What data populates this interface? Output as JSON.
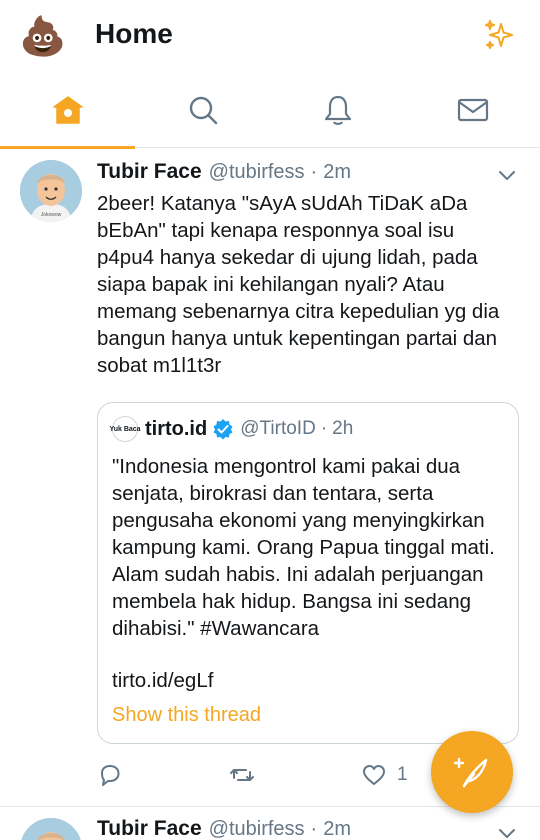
{
  "header": {
    "title": "Home",
    "avatar_icon": "poop-emoji",
    "avatar_glyph": "💩",
    "sparkle_icon": "sparkle-icon"
  },
  "tabs": [
    {
      "name": "home",
      "icon": "home-icon",
      "active": true
    },
    {
      "name": "search",
      "icon": "search-icon",
      "active": false
    },
    {
      "name": "notifications",
      "icon": "bell-icon",
      "active": false
    },
    {
      "name": "messages",
      "icon": "mail-icon",
      "active": false
    }
  ],
  "tweet": {
    "name": "Tubir Face",
    "handle": "@tubirfess",
    "separator": "·",
    "time": "2m",
    "lines": [
      "2beer! Katanya \"sAyA sUdAh TiDaK aDa",
      "bEbAn\" tapi kenapa responnya soal isu",
      "p4pu4 hanya sekedar di ujung lidah, pada",
      "siapa bapak ini kehilangan nyali? Atau",
      "memang sebenarnya citra kepedulian yg dia",
      "bangun hanya untuk kepentingan partai dan",
      "sobat m1l1t3r"
    ],
    "quote": {
      "name": "tirto.id",
      "handle": "@TirtoID",
      "separator": "·",
      "time": "2h",
      "avatar_text": "Yuk Baca",
      "lines": [
        "\"Indonesia mengontrol kami pakai dua",
        "senjata, birokrasi dan tentara, serta",
        "pengusaha ekonomi yang menyingkirkan",
        "kampung kami. Orang Papua tinggal mati.",
        "Alam sudah habis. Ini adalah perjuangan",
        "membela hak hidup. Bangsa ini sedang",
        "dihabisi.\" #Wawancara"
      ],
      "link": "tirto.id/egLf",
      "show_thread": "Show this thread"
    },
    "actions": {
      "reply_icon": "reply-icon",
      "retweet_icon": "retweet-icon",
      "like_icon": "heart-icon",
      "like_count": "1"
    }
  },
  "tweet2": {
    "name": "Tubir Face",
    "handle": "@tubirfess",
    "separator": "·",
    "time": "2m"
  },
  "fab": {
    "icon": "compose-feather-icon"
  },
  "colors": {
    "accent": "#f5a623",
    "text": "#14171a",
    "secondary": "#657786",
    "border": "#e1e8ed",
    "verified": "#1da1f2"
  }
}
